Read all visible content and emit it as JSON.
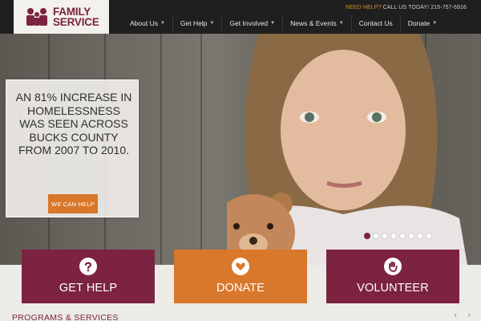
{
  "logo": {
    "line1": "FAMILY",
    "line2": "SERVICE"
  },
  "topline": {
    "need_help": "NEED HELP?",
    "call": "CALL US TODAY! 215-757-6916"
  },
  "nav": [
    {
      "label": "About Us",
      "caret": true
    },
    {
      "label": "Get Help",
      "caret": true
    },
    {
      "label": "Get Involved",
      "caret": true
    },
    {
      "label": "News & Events",
      "caret": true
    },
    {
      "label": "Contact Us",
      "caret": false
    },
    {
      "label": "Donate",
      "caret": true
    }
  ],
  "hero": {
    "message": "AN 81% INCREASE IN HOMELESSNESS WAS SEEN ACROSS BUCKS COUNTY FROM 2007 TO 2010.",
    "cta_label": "WE CAN HELP",
    "slides_total": 8,
    "slide_active": 1
  },
  "tiles": [
    {
      "label": "GET HELP",
      "icon": "question-icon",
      "color": "#7b2340"
    },
    {
      "label": "DONATE",
      "icon": "heart-icon",
      "color": "#d9772a"
    },
    {
      "label": "VOLUNTEER",
      "icon": "hand-icon",
      "color": "#7b2340"
    }
  ],
  "section": {
    "programs_title": "PROGRAMS & SERVICES",
    "prev": "‹",
    "next": "›"
  },
  "colors": {
    "brand": "#7b2340",
    "accent": "#d9772a",
    "header_bg": "#1f1f1f"
  }
}
